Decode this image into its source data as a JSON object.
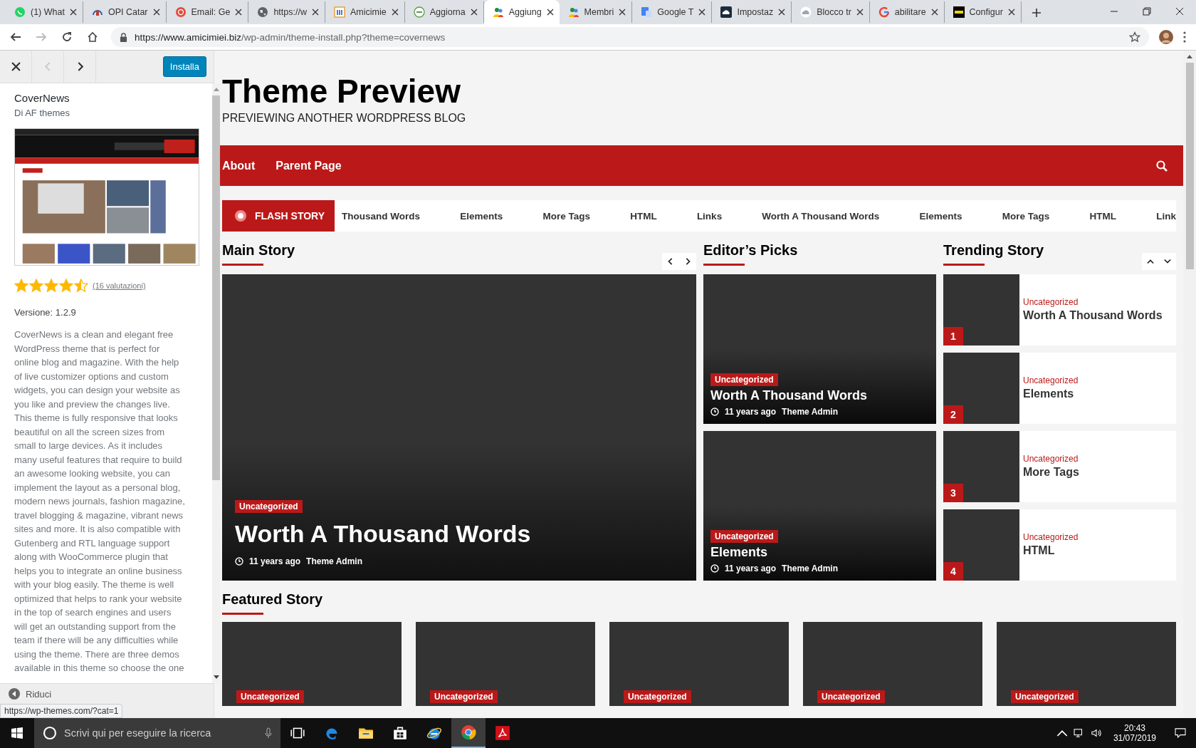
{
  "browser": {
    "tabs": [
      {
        "title": "(1) What",
        "selected": false
      },
      {
        "title": "OPI Catar",
        "selected": false
      },
      {
        "title": "Email: Ge",
        "selected": false
      },
      {
        "title": "https://w",
        "selected": false
      },
      {
        "title": "Amicimie",
        "selected": false
      },
      {
        "title": "Aggiorna",
        "selected": false
      },
      {
        "title": "Aggiung",
        "selected": true
      },
      {
        "title": "Membri",
        "selected": false
      },
      {
        "title": "Google T",
        "selected": false
      },
      {
        "title": "Impostaz",
        "selected": false
      },
      {
        "title": "Blocco tr",
        "selected": false
      },
      {
        "title": "abilitare",
        "selected": false
      },
      {
        "title": "Configur",
        "selected": false
      }
    ],
    "url_host": "https://www.amicimiei.biz",
    "url_path": "/wp-admin/theme-install.php?theme=covernews"
  },
  "sidebar": {
    "install_button": "Installa",
    "theme_name": "CoverNews",
    "author": "Di AF themes",
    "stars": 4.5,
    "ratings_link": "(16 valutazioni)",
    "version": "Versione: 1.2.9",
    "description": "CoverNews is a clean and elegant free WordPress theme that is perfect for online blog and magazine. With the help of live customizer options and custom widgets, you can design your website as you like and preview the changes live. This theme is fully responsive that looks beautiful on all the screen sizes from small to large devices. As it includes many useful features that require to build an awesome looking website, you can implement the layout as a personal blog, modern news journals, fashion magazine, travel blogging & magazine, vibrant news sites and more. It is also compatible with Gutenberg and RTL language support along with WooCommerce plugin that helps you to integrate an online business with your blog easily. The theme is well optimized that helps to rank your website in the top of search engines and users will get an outstanding support from the team if there will be any difficulties while using the theme. There are three demos available in this theme so choose the one",
    "collapse": "Riduci"
  },
  "status_url": "https://wp-themes.com/?cat=1",
  "preview": {
    "site_title": "Theme Preview",
    "tagline": "PREVIEWING ANOTHER WORDPRESS BLOG",
    "nav": [
      "About",
      "Parent Page"
    ],
    "flash_label": "FLASH STORY",
    "flash_items": [
      "Thousand Words",
      "Elements",
      "More Tags",
      "HTML",
      "Links",
      "Worth A Thousand Words",
      "Elements",
      "More Tags",
      "HTML",
      "Link"
    ],
    "main_story": {
      "heading": "Main Story",
      "badge": "Uncategorized",
      "title": "Worth A Thousand Words",
      "time": "11 years ago",
      "author": "Theme Admin"
    },
    "editors_picks": {
      "heading": "Editor’s Picks",
      "posts": [
        {
          "badge": "Uncategorized",
          "title": "Worth A Thousand Words",
          "time": "11 years ago",
          "author": "Theme Admin"
        },
        {
          "badge": "Uncategorized",
          "title": "Elements",
          "time": "11 years ago",
          "author": "Theme Admin"
        }
      ]
    },
    "trending": {
      "heading": "Trending Story",
      "posts": [
        {
          "number": "1",
          "category": "Uncategorized",
          "title": "Worth A Thousand Words"
        },
        {
          "number": "2",
          "category": "Uncategorized",
          "title": "Elements"
        },
        {
          "number": "3",
          "category": "Uncategorized",
          "title": "More Tags"
        },
        {
          "number": "4",
          "category": "Uncategorized",
          "title": "HTML"
        }
      ]
    },
    "featured": {
      "heading": "Featured Story",
      "posts": [
        {
          "badge": "Uncategorized"
        },
        {
          "badge": "Uncategorized"
        },
        {
          "badge": "Uncategorized"
        },
        {
          "badge": "Uncategorized"
        },
        {
          "badge": "Uncategorized"
        }
      ]
    }
  },
  "taskbar": {
    "search_placeholder": "Scrivi qui per eseguire la ricerca",
    "apps": [
      {
        "active": false
      },
      {
        "active": false
      },
      {
        "active": false
      },
      {
        "active": false
      },
      {
        "active": false
      },
      {
        "active": true
      },
      {
        "active": false
      }
    ],
    "time": "20:43",
    "date": "31/07/2019"
  }
}
